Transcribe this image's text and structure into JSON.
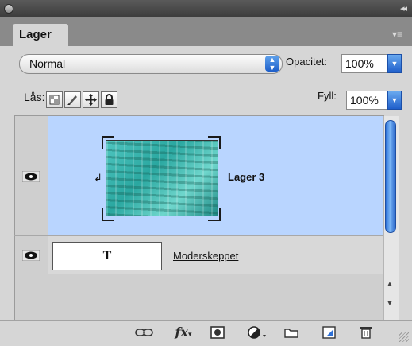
{
  "panel": {
    "tab_label": "Lager"
  },
  "blend": {
    "mode": "Normal",
    "opacity_label": "Opacitet:",
    "opacity_value": "100%"
  },
  "lock": {
    "label": "Lås:",
    "fill_label": "Fyll:",
    "fill_value": "100%"
  },
  "layers": [
    {
      "name": "Lager 3",
      "visible": true,
      "selected": true,
      "type": "image",
      "clipped": true
    },
    {
      "name": "Moderskeppet",
      "visible": true,
      "selected": false,
      "type": "text",
      "thumb_glyph": "T"
    }
  ],
  "toolbar": {
    "icons": [
      "link-layers-icon",
      "fx-icon",
      "add-mask-icon",
      "adjustment-layer-icon",
      "new-group-icon",
      "new-layer-icon",
      "delete-layer-icon"
    ],
    "fx_label": "fx"
  },
  "colors": {
    "selected_row": "#b9d5ff",
    "accent_blue": "#2c6fd6"
  }
}
